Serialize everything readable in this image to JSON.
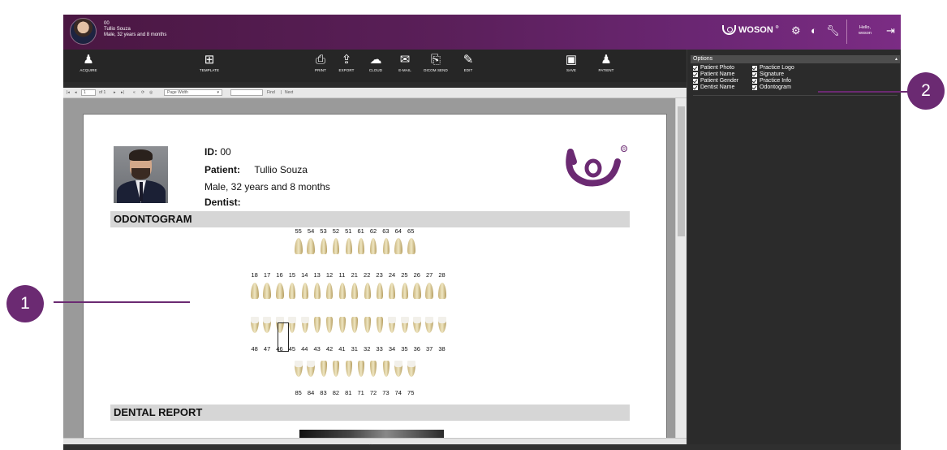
{
  "header": {
    "patient_id": "00",
    "patient_name": "Tullio Souza",
    "patient_summary": "Male, 32 years and 8 months",
    "brand": "WOSON",
    "greeting": "Hello,",
    "user": "woson"
  },
  "toolbar": {
    "acquire": "ACQUIRE",
    "template": "TEMPLATE",
    "print": "PRINT",
    "export": "EXPORT",
    "cloud": "CLOUD",
    "email": "E-MAIL",
    "dicom_send": "DICOM SEND",
    "edit": "EDIT",
    "save": "SAVE",
    "patient": "PATIENT"
  },
  "viewer": {
    "page_input": "1",
    "of_pages": "of 1",
    "zoom_select": "Page Width",
    "find": "Find",
    "next": "Next"
  },
  "report": {
    "id_label": "ID:",
    "id_value": "00",
    "patient_label": "Patient:",
    "patient_value": "Tullio Souza",
    "sex_age": "Male, 32 years and 8 months",
    "dentist_label": "Dentist:",
    "odontogram_title": "ODONTOGRAM",
    "dental_report_title": "DENTAL REPORT",
    "upper_deciduous": [
      "55",
      "54",
      "53",
      "52",
      "51",
      "61",
      "62",
      "63",
      "64",
      "65"
    ],
    "upper_permanent": [
      "18",
      "17",
      "16",
      "15",
      "14",
      "13",
      "12",
      "11",
      "21",
      "22",
      "23",
      "24",
      "25",
      "26",
      "27",
      "28"
    ],
    "lower_permanent": [
      "48",
      "47",
      "46",
      "45",
      "44",
      "43",
      "42",
      "41",
      "31",
      "32",
      "33",
      "34",
      "35",
      "36",
      "37",
      "38"
    ],
    "lower_deciduous": [
      "85",
      "84",
      "83",
      "82",
      "81",
      "71",
      "72",
      "73",
      "74",
      "75"
    ],
    "selected_tooth": "46"
  },
  "options": {
    "title": "Options",
    "items": [
      {
        "label": "Patient Photo",
        "checked": true
      },
      {
        "label": "Patient Name",
        "checked": true
      },
      {
        "label": "Patient Gender",
        "checked": true
      },
      {
        "label": "Dentist Name",
        "checked": true
      },
      {
        "label": "Practice Logo",
        "checked": true
      },
      {
        "label": "Signature",
        "checked": true
      },
      {
        "label": "Practice Info",
        "checked": true
      },
      {
        "label": "Odontogram",
        "checked": true
      }
    ]
  },
  "callouts": {
    "one": "1",
    "two": "2"
  },
  "colors": {
    "brand_purple": "#6b2a72",
    "header_dark": "#4a1742",
    "panel_bg": "#2b2b2b"
  }
}
